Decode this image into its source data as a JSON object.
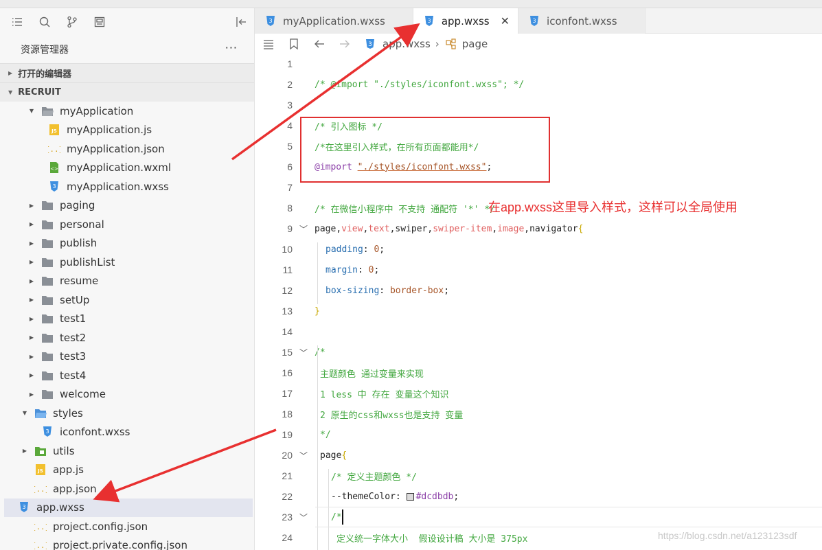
{
  "sidebar": {
    "title": "资源管理器",
    "more": "···",
    "section_open": "打开的编辑器",
    "section_project": "RECRUIT",
    "tree": [
      {
        "label": "myApplication",
        "type": "folder-open",
        "indent": 1,
        "arrow": "down"
      },
      {
        "label": "myApplication.js",
        "type": "js",
        "indent": 2,
        "arrow": "none"
      },
      {
        "label": "myApplication.json",
        "type": "json",
        "indent": 2,
        "arrow": "none"
      },
      {
        "label": "myApplication.wxml",
        "type": "wxml",
        "indent": 2,
        "arrow": "none"
      },
      {
        "label": "myApplication.wxss",
        "type": "wxss",
        "indent": 2,
        "arrow": "none"
      },
      {
        "label": "paging",
        "type": "folder",
        "indent": 1,
        "arrow": "right"
      },
      {
        "label": "personal",
        "type": "folder",
        "indent": 1,
        "arrow": "right"
      },
      {
        "label": "publish",
        "type": "folder",
        "indent": 1,
        "arrow": "right"
      },
      {
        "label": "publishList",
        "type": "folder",
        "indent": 1,
        "arrow": "right"
      },
      {
        "label": "resume",
        "type": "folder",
        "indent": 1,
        "arrow": "right"
      },
      {
        "label": "setUp",
        "type": "folder",
        "indent": 1,
        "arrow": "right"
      },
      {
        "label": "test1",
        "type": "folder",
        "indent": 1,
        "arrow": "right"
      },
      {
        "label": "test2",
        "type": "folder",
        "indent": 1,
        "arrow": "right"
      },
      {
        "label": "test3",
        "type": "folder",
        "indent": 1,
        "arrow": "right"
      },
      {
        "label": "test4",
        "type": "folder",
        "indent": 1,
        "arrow": "right"
      },
      {
        "label": "welcome",
        "type": "folder",
        "indent": 1,
        "arrow": "right"
      },
      {
        "label": "styles",
        "type": "folder-open-blue",
        "indent": 0,
        "arrow": "down"
      },
      {
        "label": "iconfont.wxss",
        "type": "wxss",
        "indent": 1,
        "arrow": "none"
      },
      {
        "label": "utils",
        "type": "folder-green",
        "indent": 0,
        "arrow": "right"
      },
      {
        "label": "app.js",
        "type": "js",
        "indent": 0,
        "arrow": "none"
      },
      {
        "label": "app.json",
        "type": "json",
        "indent": 0,
        "arrow": "none"
      },
      {
        "label": "app.wxss",
        "type": "wxss",
        "indent": 0,
        "arrow": "none",
        "selected": true
      },
      {
        "label": "project.config.json",
        "type": "json",
        "indent": 0,
        "arrow": "none"
      },
      {
        "label": "project.private.config.json",
        "type": "json",
        "indent": 0,
        "arrow": "none"
      }
    ]
  },
  "tabs": [
    {
      "label": "myApplication.wxss",
      "active": false
    },
    {
      "label": "app.wxss",
      "active": true,
      "close": "✕"
    },
    {
      "label": "iconfont.wxss",
      "active": false
    }
  ],
  "breadcrumb": {
    "file": "app.wxss",
    "symbol": "page"
  },
  "code_lines": [
    {
      "n": "1",
      "fold": "",
      "indent": 0,
      "parts": []
    },
    {
      "n": "2",
      "fold": "",
      "indent": 0,
      "parts": [
        [
          "cm",
          "/* @import \"./styles/iconfont.wxss\"; */"
        ]
      ]
    },
    {
      "n": "3",
      "fold": "",
      "indent": 0,
      "parts": []
    },
    {
      "n": "4",
      "fold": "",
      "indent": 0,
      "parts": [
        [
          "cm",
          "/* 引入图标 */"
        ]
      ]
    },
    {
      "n": "5",
      "fold": "",
      "indent": 0,
      "parts": [
        [
          "cm",
          "/*在这里引入样式，在所有页面都能用*/"
        ]
      ]
    },
    {
      "n": "6",
      "fold": "",
      "indent": 0,
      "parts": [
        [
          "kw",
          "@import "
        ],
        [
          "str",
          "\"./styles/iconfont.wxss\""
        ],
        [
          "ct",
          ";"
        ]
      ]
    },
    {
      "n": "7",
      "fold": "",
      "indent": 0,
      "parts": []
    },
    {
      "n": "8",
      "fold": "",
      "indent": 0,
      "parts": [
        [
          "cm",
          "/* 在微信小程序中 不支持 通配符 '*' */"
        ]
      ]
    },
    {
      "n": "9",
      "fold": "﹀",
      "indent": 0,
      "parts": [
        [
          "sel",
          "page"
        ],
        [
          "ct",
          ","
        ],
        [
          "tag",
          "view"
        ],
        [
          "ct",
          ","
        ],
        [
          "tag",
          "text"
        ],
        [
          "ct",
          ","
        ],
        [
          "sel",
          "swiper"
        ],
        [
          "ct",
          ","
        ],
        [
          "tag",
          "swiper-item"
        ],
        [
          "ct",
          ","
        ],
        [
          "tag",
          "image"
        ],
        [
          "ct",
          ","
        ],
        [
          "sel",
          "navigator"
        ],
        [
          "brace",
          "{"
        ]
      ]
    },
    {
      "n": "10",
      "fold": "",
      "indent": 1,
      "parts": [
        [
          "prop",
          "padding"
        ],
        [
          "ct",
          ": "
        ],
        [
          "num",
          "0"
        ],
        [
          "ct",
          ";"
        ]
      ]
    },
    {
      "n": "11",
      "fold": "",
      "indent": 1,
      "parts": [
        [
          "prop",
          "margin"
        ],
        [
          "ct",
          ": "
        ],
        [
          "num",
          "0"
        ],
        [
          "ct",
          ";"
        ]
      ]
    },
    {
      "n": "12",
      "fold": "",
      "indent": 1,
      "parts": [
        [
          "prop",
          "box-sizing"
        ],
        [
          "ct",
          ": "
        ],
        [
          "val",
          "border-box"
        ],
        [
          "ct",
          ";"
        ]
      ]
    },
    {
      "n": "13",
      "fold": "",
      "indent": 0,
      "parts": [
        [
          "brace",
          "}"
        ]
      ]
    },
    {
      "n": "14",
      "fold": "",
      "indent": 0,
      "parts": []
    },
    {
      "n": "15",
      "fold": "﹀",
      "indent": 0,
      "parts": [
        [
          "cm",
          "/*"
        ]
      ]
    },
    {
      "n": "16",
      "fold": "",
      "indent": 0.5,
      "parts": [
        [
          "cm",
          "主题颜色 通过变量来实现"
        ]
      ]
    },
    {
      "n": "17",
      "fold": "",
      "indent": 0.5,
      "parts": [
        [
          "cm",
          "1 less 中 存在 变量这个知识"
        ]
      ]
    },
    {
      "n": "18",
      "fold": "",
      "indent": 0.5,
      "parts": [
        [
          "cm",
          "2 原生的css和wxss也是支持 变量"
        ]
      ]
    },
    {
      "n": "19",
      "fold": "",
      "indent": 0.5,
      "parts": [
        [
          "cm",
          "*/"
        ]
      ]
    },
    {
      "n": "20",
      "fold": "﹀",
      "indent": 0.5,
      "parts": [
        [
          "sel",
          "page"
        ],
        [
          "brace",
          "{"
        ]
      ]
    },
    {
      "n": "21",
      "fold": "",
      "indent": 1.5,
      "parts": [
        [
          "cm",
          "/* 定义主题颜色 */"
        ]
      ]
    },
    {
      "n": "22",
      "fold": "",
      "indent": 1.5,
      "parts": [
        [
          "sel",
          "--themeColor"
        ],
        [
          "ct",
          ": "
        ],
        [
          "swatch",
          ""
        ],
        [
          "kw",
          "#dcdbdb"
        ],
        [
          "ct",
          ";"
        ]
      ]
    },
    {
      "n": "23",
      "fold": "﹀",
      "indent": 1.5,
      "parts": [
        [
          "cm",
          "/*"
        ]
      ]
    },
    {
      "n": "24",
      "fold": "",
      "indent": 2,
      "parts": [
        [
          "cm",
          "定义统一字体大小  假设设计稿 大小是 375px"
        ]
      ]
    }
  ],
  "annotation": "在app.wxss这里导入样式，这样可以全局使用",
  "watermark": "https://blog.csdn.net/a123123sdf",
  "colors": {
    "arrow": "#e83030",
    "comment": "#42a73f",
    "keyword": "#8b3fa8"
  }
}
